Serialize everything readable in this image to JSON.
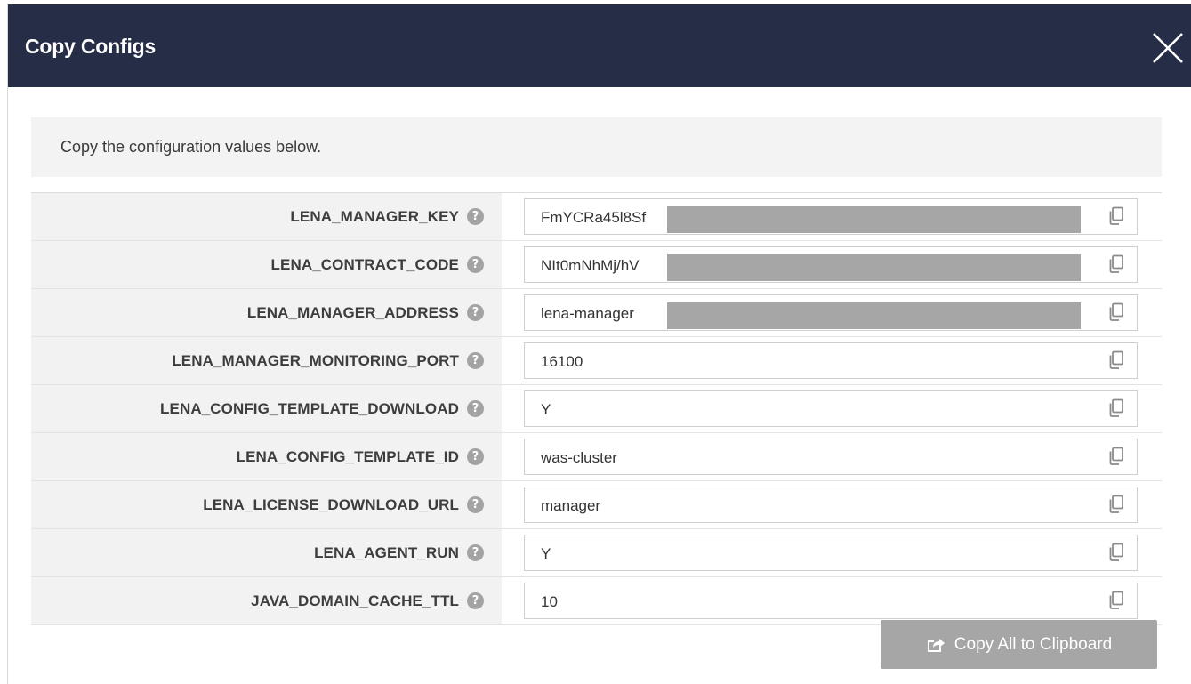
{
  "modal": {
    "title": "Copy Configs",
    "close_icon": "close-icon"
  },
  "info": {
    "text": "Copy the configuration values below."
  },
  "configs": [
    {
      "key": "LENA_MANAGER_KEY",
      "value": "FmYCRa45l8Sf",
      "masked": true
    },
    {
      "key": "LENA_CONTRACT_CODE",
      "value": "NIt0mNhMj/hV",
      "masked": true
    },
    {
      "key": "LENA_MANAGER_ADDRESS",
      "value": "lena-manager",
      "masked": true
    },
    {
      "key": "LENA_MANAGER_MONITORING_PORT",
      "value": "16100",
      "masked": false
    },
    {
      "key": "LENA_CONFIG_TEMPLATE_DOWNLOAD",
      "value": "Y",
      "masked": false
    },
    {
      "key": "LENA_CONFIG_TEMPLATE_ID",
      "value": "was-cluster",
      "masked": false
    },
    {
      "key": "LENA_LICENSE_DOWNLOAD_URL",
      "value": "manager",
      "masked": false
    },
    {
      "key": "LENA_AGENT_RUN",
      "value": "Y",
      "masked": false
    },
    {
      "key": "JAVA_DOMAIN_CACHE_TTL",
      "value": "10",
      "masked": false
    }
  ],
  "help_icon_glyph": "?",
  "footer": {
    "copy_all_label": "Copy All to Clipboard",
    "copy_all_icon": "share-icon"
  },
  "colors": {
    "header_bg": "#252d47",
    "button_disabled": "#a6a6a6",
    "label_bg": "#f2f2f2"
  }
}
